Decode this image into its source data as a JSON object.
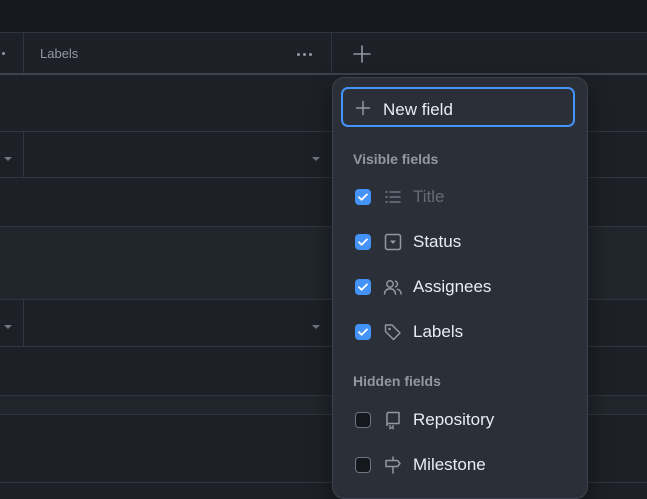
{
  "header": {
    "labels_column": "Labels"
  },
  "menu": {
    "new_field_label": "New field",
    "visible_title": "Visible fields",
    "hidden_title": "Hidden fields",
    "visible_items": [
      {
        "label": "Title",
        "checked": true,
        "icon": "list-icon"
      },
      {
        "label": "Status",
        "checked": true,
        "icon": "single-select-icon"
      },
      {
        "label": "Assignees",
        "checked": true,
        "icon": "people-icon"
      },
      {
        "label": "Labels",
        "checked": true,
        "icon": "tag-icon"
      }
    ],
    "hidden_items": [
      {
        "label": "Repository",
        "checked": false,
        "icon": "repo-icon"
      },
      {
        "label": "Milestone",
        "checked": false,
        "icon": "milestone-icon"
      }
    ]
  },
  "colors": {
    "accent": "#4493f8",
    "background": "#1d2026",
    "menu_background": "#2b3038"
  }
}
